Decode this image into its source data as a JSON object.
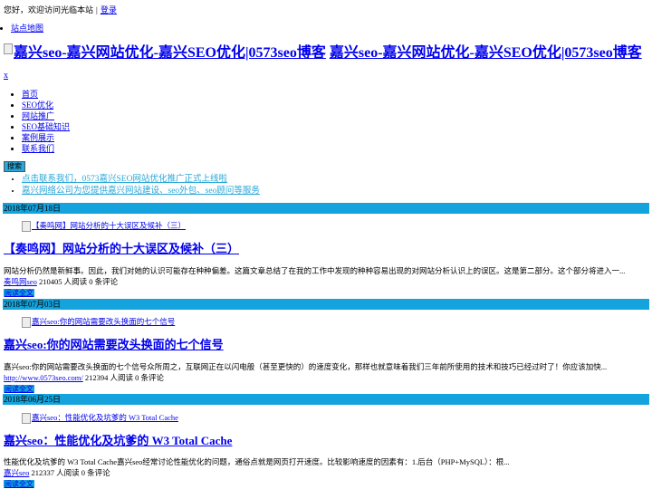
{
  "topbar": {
    "welcome": "您好，欢迎访问光临本站",
    "separator": "|",
    "login": "登录"
  },
  "sitemap": {
    "label": "站点地图"
  },
  "logo": {
    "alt1": "嘉兴seo-嘉兴网站优化-嘉兴SEO优化|0573seo博客",
    "alt2": "嘉兴seo-嘉兴网站优化-嘉兴SEO优化|0573seo博客"
  },
  "close": {
    "label": "x"
  },
  "nav": {
    "items": [
      "首页",
      "SEO优化",
      "网站推广",
      "SEO基础知识",
      "案例展示",
      "联系我们"
    ]
  },
  "search": {
    "button": "搜索"
  },
  "notices": [
    "点击联系我们，0573嘉兴SEO网站优化推广正式上线啦",
    "嘉兴网络公司为您提供嘉兴网站建设、seo外包、seo顾问等服务"
  ],
  "posts": [
    {
      "date": "2018年07月18日",
      "thumb_alt": "【奏鸣网】网站分析的十大误区及候补（三）",
      "title": "【奏鸣网】网站分析的十大误区及候补（三）",
      "excerpt": "网站分析仍然是新鲜事。因此，我们对她的认识可能存在种种偏差。这篇文章总结了在我的工作中发现的种种容易出现的对网站分析认识上的误区。这是第二部分。这个部分将进入一...",
      "author": "奏鸣网seo",
      "stats": "210405 人阅读 0 条评论",
      "read_more": "阅读全文"
    },
    {
      "date": "2018年07月03日",
      "thumb_alt": "嘉兴seo:你的网站需要改头换面的七个信号",
      "title": "嘉兴seo:你的网站需要改头换面的七个信号",
      "excerpt": "嘉兴seo:你的网站需要改头换面的七个信号众所周之，互联网正在以闪电般（甚至更快的）的速度变化，那样也就意味着我们三年前所使用的技术和技巧已经过时了！你应该加快...",
      "author": "http://www.0573seo.com/",
      "stats": "212394 人阅读 0 条评论",
      "read_more": "阅读全文"
    },
    {
      "date": "2018年06月25日",
      "thumb_alt": "嘉兴seo：性能优化及坑爹的 W3 Total Cache",
      "title": "嘉兴seo：性能优化及坑爹的 W3 Total Cache",
      "excerpt": "性能优化及坑爹的 W3 Total Cache嘉兴seo经常讨论性能优化的问题，通俗点就是网页打开速度。比较影响速度的因素有：1.后台（PHP+MySQL）：根...",
      "author": "嘉兴seo",
      "stats": "212337 人阅读 0 条评论",
      "read_more": "阅读全文"
    }
  ]
}
